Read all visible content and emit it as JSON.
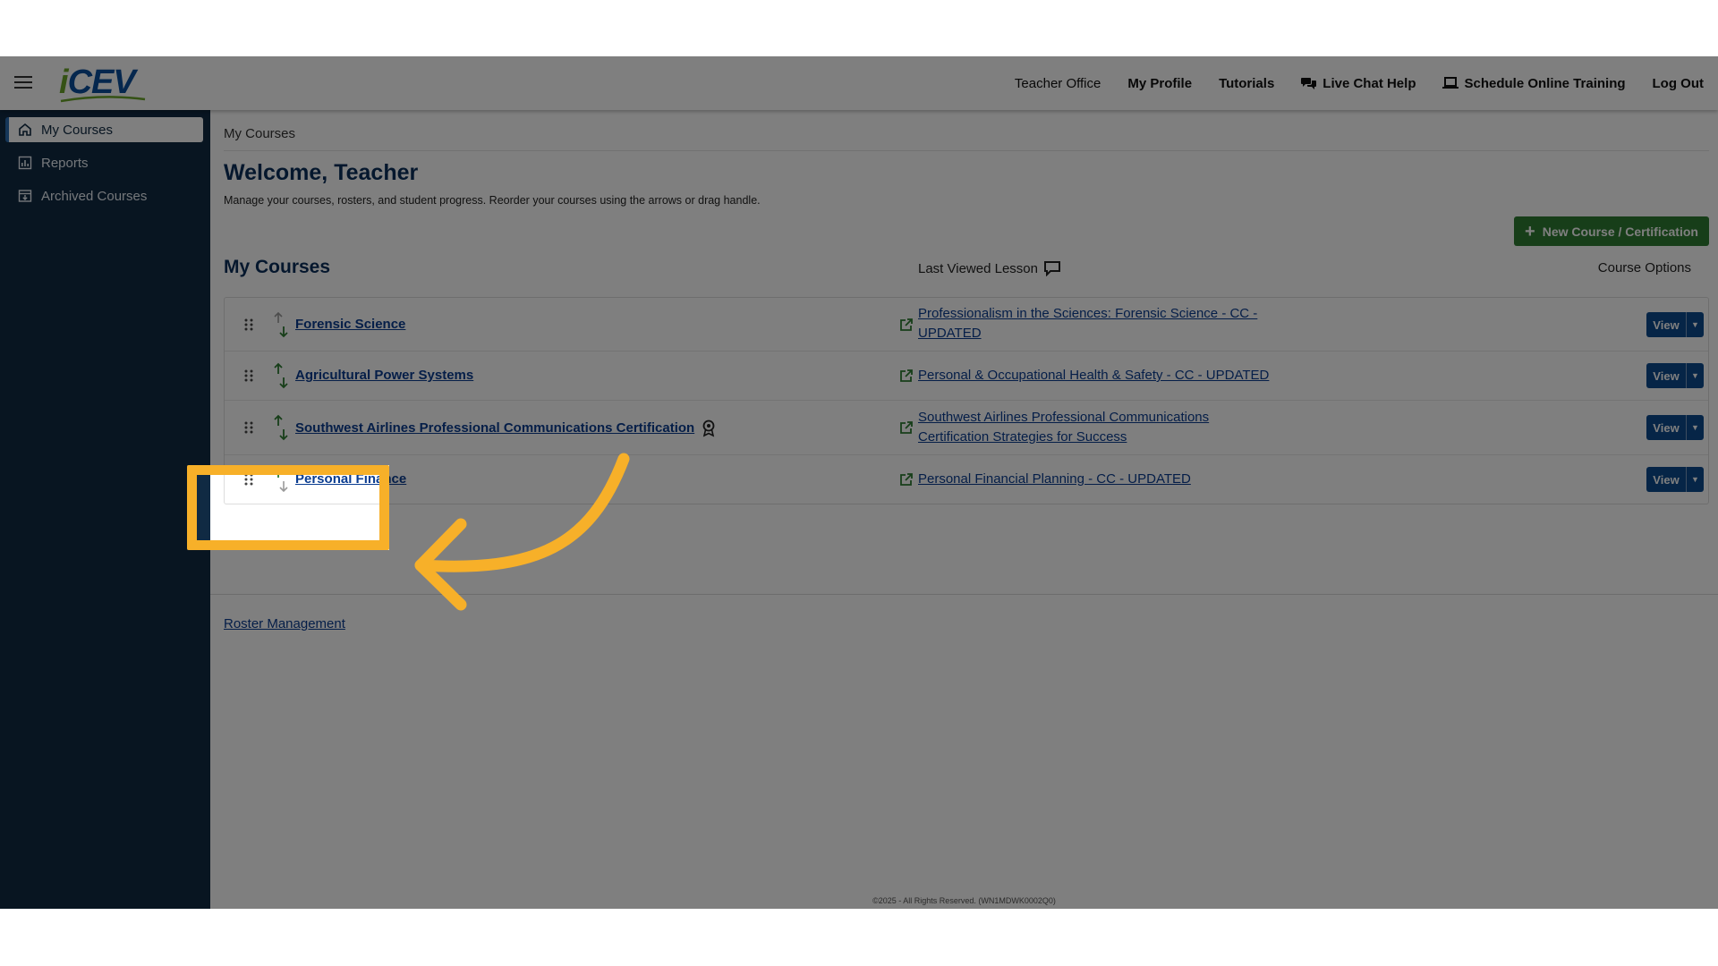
{
  "header": {
    "logo_i": "i",
    "logo_cev": "CEV",
    "nav": [
      {
        "label": "Teacher Office"
      },
      {
        "label": "My Profile"
      },
      {
        "label": "Tutorials"
      },
      {
        "label": "Live Chat Help",
        "icon": "chat-icon"
      },
      {
        "label": "Schedule Online Training",
        "icon": "laptop-icon"
      },
      {
        "label": "Log Out"
      }
    ]
  },
  "sidebar": {
    "items": [
      {
        "label": "My Courses",
        "icon": "home-icon",
        "active": true
      },
      {
        "label": "Reports",
        "icon": "report-icon"
      },
      {
        "label": "Archived Courses",
        "icon": "archive-icon"
      }
    ]
  },
  "main": {
    "breadcrumb": "My Courses",
    "welcome": "Welcome, Teacher",
    "subtitle": "Manage your courses, rosters, and student progress. Reorder your courses using the arrows or drag handle.",
    "new_course_label": "New Course / Certification",
    "section_title": "My Courses",
    "last_viewed_label": "Last Viewed Lesson",
    "course_options_label": "Course Options",
    "courses": [
      {
        "name": "Forensic Science",
        "lesson": "Professionalism in the Sciences: Forensic Science - CC - UPDATED",
        "view": "View"
      },
      {
        "name": "Agricultural Power Systems",
        "lesson": "Personal & Occupational Health & Safety - CC - UPDATED",
        "view": "View"
      },
      {
        "name": "Southwest Airlines Professional Communications Certification",
        "lesson": "Southwest Airlines Professional Communications Certification Strategies for Success",
        "view": "View",
        "certification": true
      },
      {
        "name": "Personal Finance",
        "lesson": "Personal Financial Planning - CC - UPDATED",
        "view": "View"
      }
    ],
    "roster_link": "Roster Management",
    "footer": "©2025 - All Rights Reserved. (WN1MDWK0002Q0)"
  },
  "colors": {
    "sidebar_bg": "#102a43",
    "primary_blue": "#0d4a8f",
    "green_button": "#2e7d32",
    "highlight": "#f7b029"
  }
}
